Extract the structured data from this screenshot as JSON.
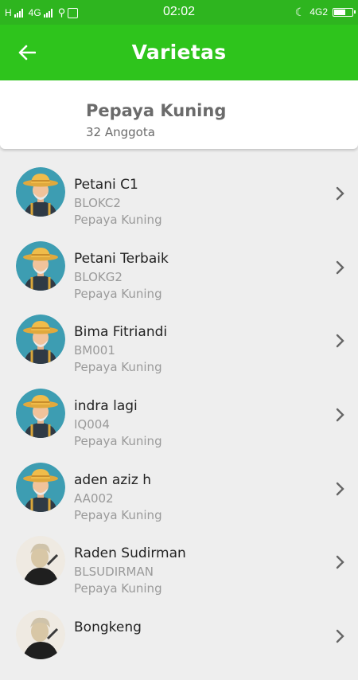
{
  "status_bar": {
    "network_left": "H",
    "network_mid": "4G",
    "time": "02:02",
    "network_right": "4G2",
    "icons": [
      "signal-icon",
      "usb-icon",
      "notification-icon",
      "moon-icon",
      "battery-icon"
    ]
  },
  "app_bar": {
    "title": "Varietas",
    "back_icon": "arrow-left-icon",
    "color": "#2ec41c"
  },
  "group": {
    "name": "Pepaya Kuning",
    "count": "32 Anggota"
  },
  "members": [
    {
      "name": "Petani C1",
      "code": "BLOKC2",
      "variety": "Pepaya Kuning",
      "avatar": "farmer-avatar"
    },
    {
      "name": "Petani Terbaik",
      "code": "BLOKG2",
      "variety": "Pepaya Kuning",
      "avatar": "farmer-avatar"
    },
    {
      "name": "Bima Fitriandi",
      "code": "BM001",
      "variety": "Pepaya Kuning",
      "avatar": "farmer-avatar"
    },
    {
      "name": "indra lagi",
      "code": "IQ004",
      "variety": "Pepaya Kuning",
      "avatar": "farmer-avatar"
    },
    {
      "name": "aden aziz h",
      "code": "AA002",
      "variety": "Pepaya Kuning",
      "avatar": "farmer-avatar"
    },
    {
      "name": "Raden Sudirman",
      "code": "BLSUDIRMAN",
      "variety": "Pepaya Kuning",
      "avatar": "photo-avatar"
    },
    {
      "name": "Bongkeng",
      "code": "",
      "variety": "",
      "avatar": "photo-avatar"
    }
  ]
}
